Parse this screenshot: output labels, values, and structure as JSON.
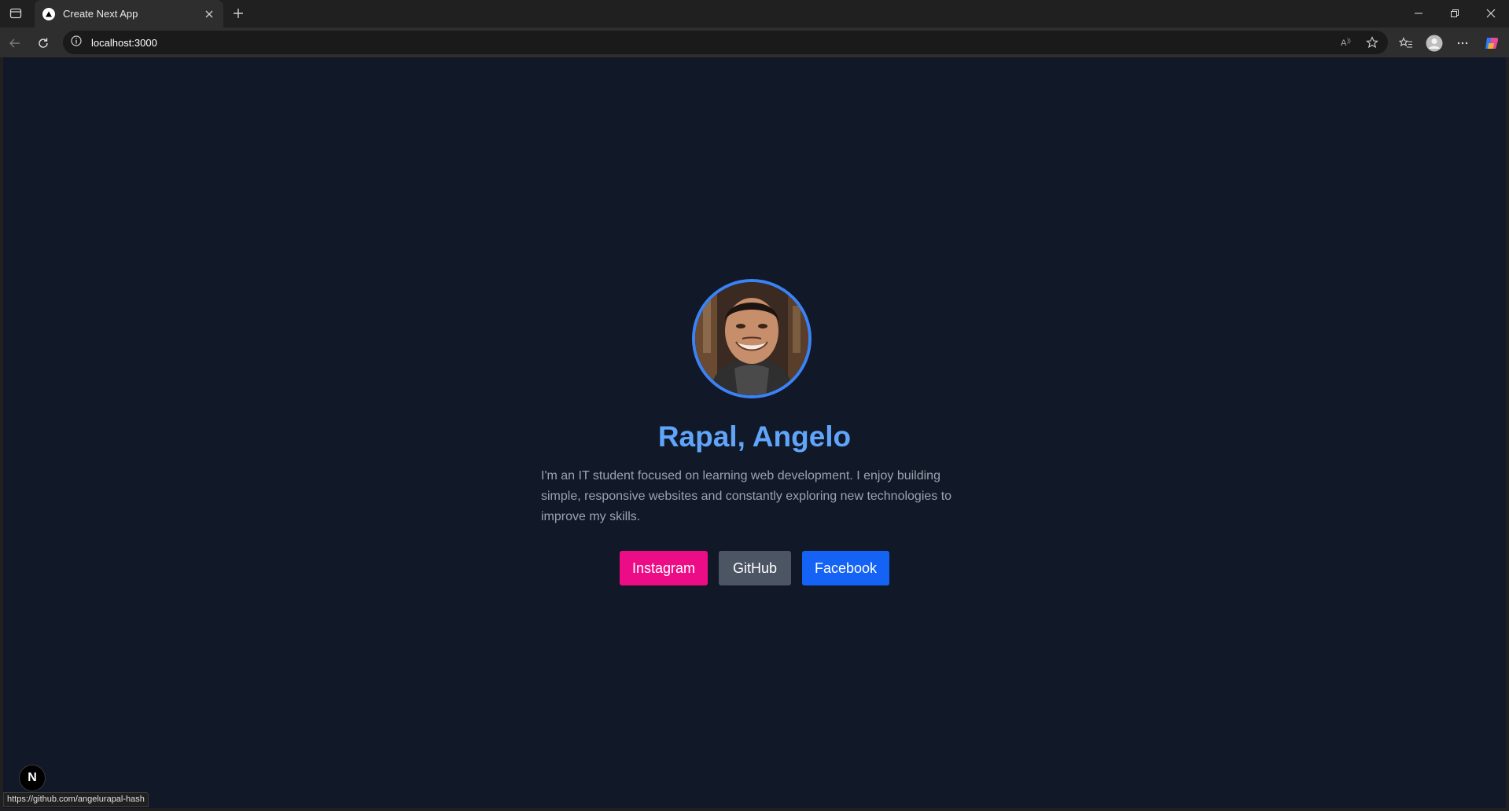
{
  "browser": {
    "tab": {
      "title": "Create Next App",
      "favicon": "nextjs-triangle-icon"
    },
    "address": {
      "url": "localhost:3000"
    },
    "status_url": "https://github.com/angelurapal-hash"
  },
  "profile": {
    "name": "Rapal, Angelo",
    "bio": "I'm an IT student focused on learning web development. I enjoy building simple, responsive websites and constantly exploring new technologies to improve my skills.",
    "avatar_icon": "profile-photo"
  },
  "socials": [
    {
      "label": "Instagram",
      "color": "#ec0d86"
    },
    {
      "label": "GitHub",
      "color": "#4b5563"
    },
    {
      "label": "Facebook",
      "color": "#1463f5"
    }
  ],
  "next_badge": {
    "label": "N"
  },
  "colors": {
    "page_bg": "#111827",
    "accent": "#3b82f6",
    "name": "#60a5fa",
    "bio_text": "#9ca3af"
  }
}
